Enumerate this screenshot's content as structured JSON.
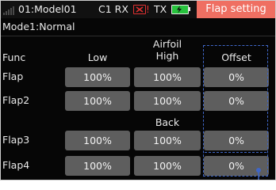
{
  "status_bar": {
    "model_label": "01:Model01",
    "rx_label": "C1 RX",
    "rx_warning": "!",
    "tx_label": "TX",
    "page_title": "Flap setting",
    "icons": {
      "signal": "signal-bars-icon",
      "rx_battery": "battery-empty-icon",
      "tx_battery": "battery-charging-icon"
    },
    "colors": {
      "title_bg": "#ef6f62",
      "rx_battery": "#e23030",
      "tx_battery": "#27c33d"
    }
  },
  "mode_line": "Mode1:Normal",
  "table": {
    "header_func": "Func",
    "group_airfoil": "Airfoil",
    "header_low": "Low",
    "header_high": "High",
    "header_offset": "Offset",
    "group_back": "Back",
    "rows": [
      {
        "func": "Flap",
        "low": "100%",
        "high": "100%",
        "offset": "0%"
      },
      {
        "func": "Flap2",
        "low": "100%",
        "high": "100%",
        "offset": "0%"
      },
      {
        "func": "Flap3",
        "low": "100%",
        "high": "100%",
        "offset": "0%"
      },
      {
        "func": "Flap4",
        "low": "100%",
        "high": "100%",
        "offset": "0%"
      }
    ]
  },
  "colors": {
    "background": "#060606",
    "cell": "#5e5e5e",
    "selection_frame": "#3f66c6"
  }
}
